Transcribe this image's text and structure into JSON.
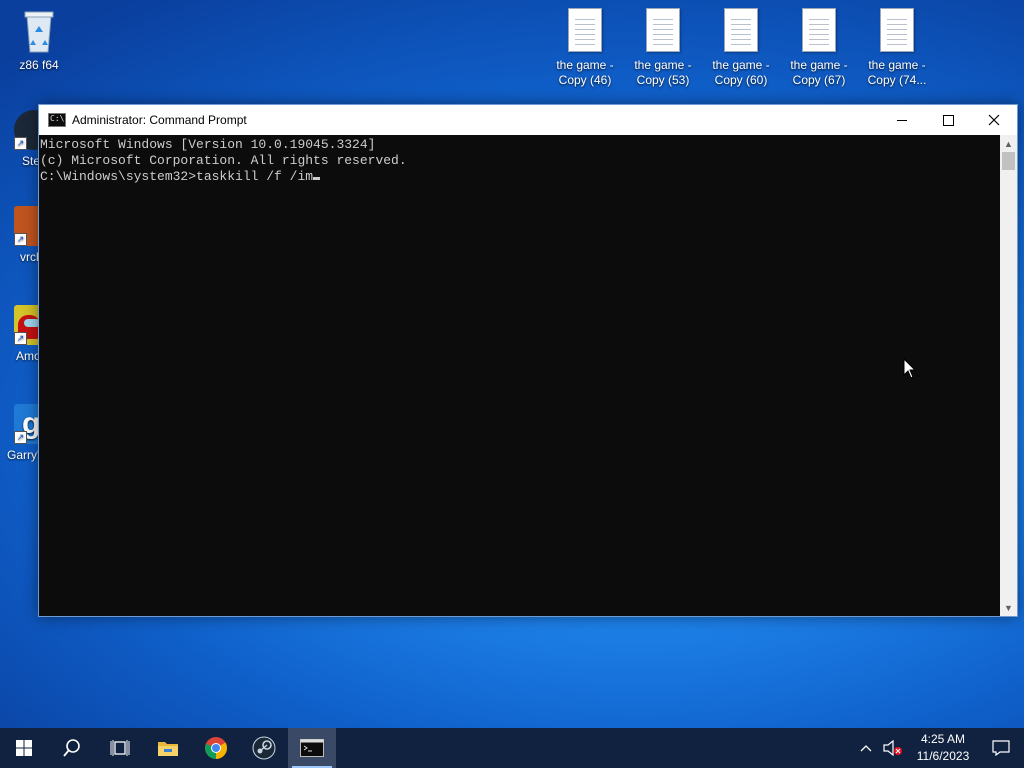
{
  "desktop": {
    "top_icons": [
      {
        "label": "z86 f64",
        "icon": "recycle-bin-icon"
      },
      {
        "label": "the game -\nCopy (46)",
        "icon": "text-file-icon"
      },
      {
        "label": "the game -\nCopy (53)",
        "icon": "text-file-icon"
      },
      {
        "label": "the game -\nCopy (60)",
        "icon": "text-file-icon"
      },
      {
        "label": "the game -\nCopy (67)",
        "icon": "text-file-icon"
      },
      {
        "label": "the game -\nCopy (74...",
        "icon": "text-file-icon"
      }
    ],
    "left_icons": [
      {
        "label": "Ste",
        "icon": "steam-shortcut-icon",
        "color": "#1b2838"
      },
      {
        "label": "vrcl",
        "icon": "vrchat-shortcut-icon",
        "color": "#c0541f"
      },
      {
        "label": "Amo",
        "icon": "among-us-shortcut-icon",
        "color": "#d4c32a"
      },
      {
        "label": "Garry'",
        "icon": "garrys-mod-shortcut-icon",
        "color": "#1f7ad6"
      }
    ]
  },
  "window": {
    "title": "Administrator: Command Prompt",
    "console_lines": [
      "Microsoft Windows [Version 10.0.19045.3324]",
      "(c) Microsoft Corporation. All rights reserved.",
      "",
      "C:\\Windows\\system32>taskkill /f /im"
    ]
  },
  "taskbar": {
    "items": [
      "windows-start-icon",
      "search-icon",
      "task-view-icon",
      "file-explorer-icon",
      "chrome-icon",
      "steam-icon",
      "command-prompt-icon"
    ],
    "tray": {
      "time": "4:25 AM",
      "date": "11/6/2023"
    }
  },
  "colors": {
    "console_bg": "#0c0c0c",
    "console_fg": "#cccccc",
    "taskbar_bg": "#10223f"
  }
}
